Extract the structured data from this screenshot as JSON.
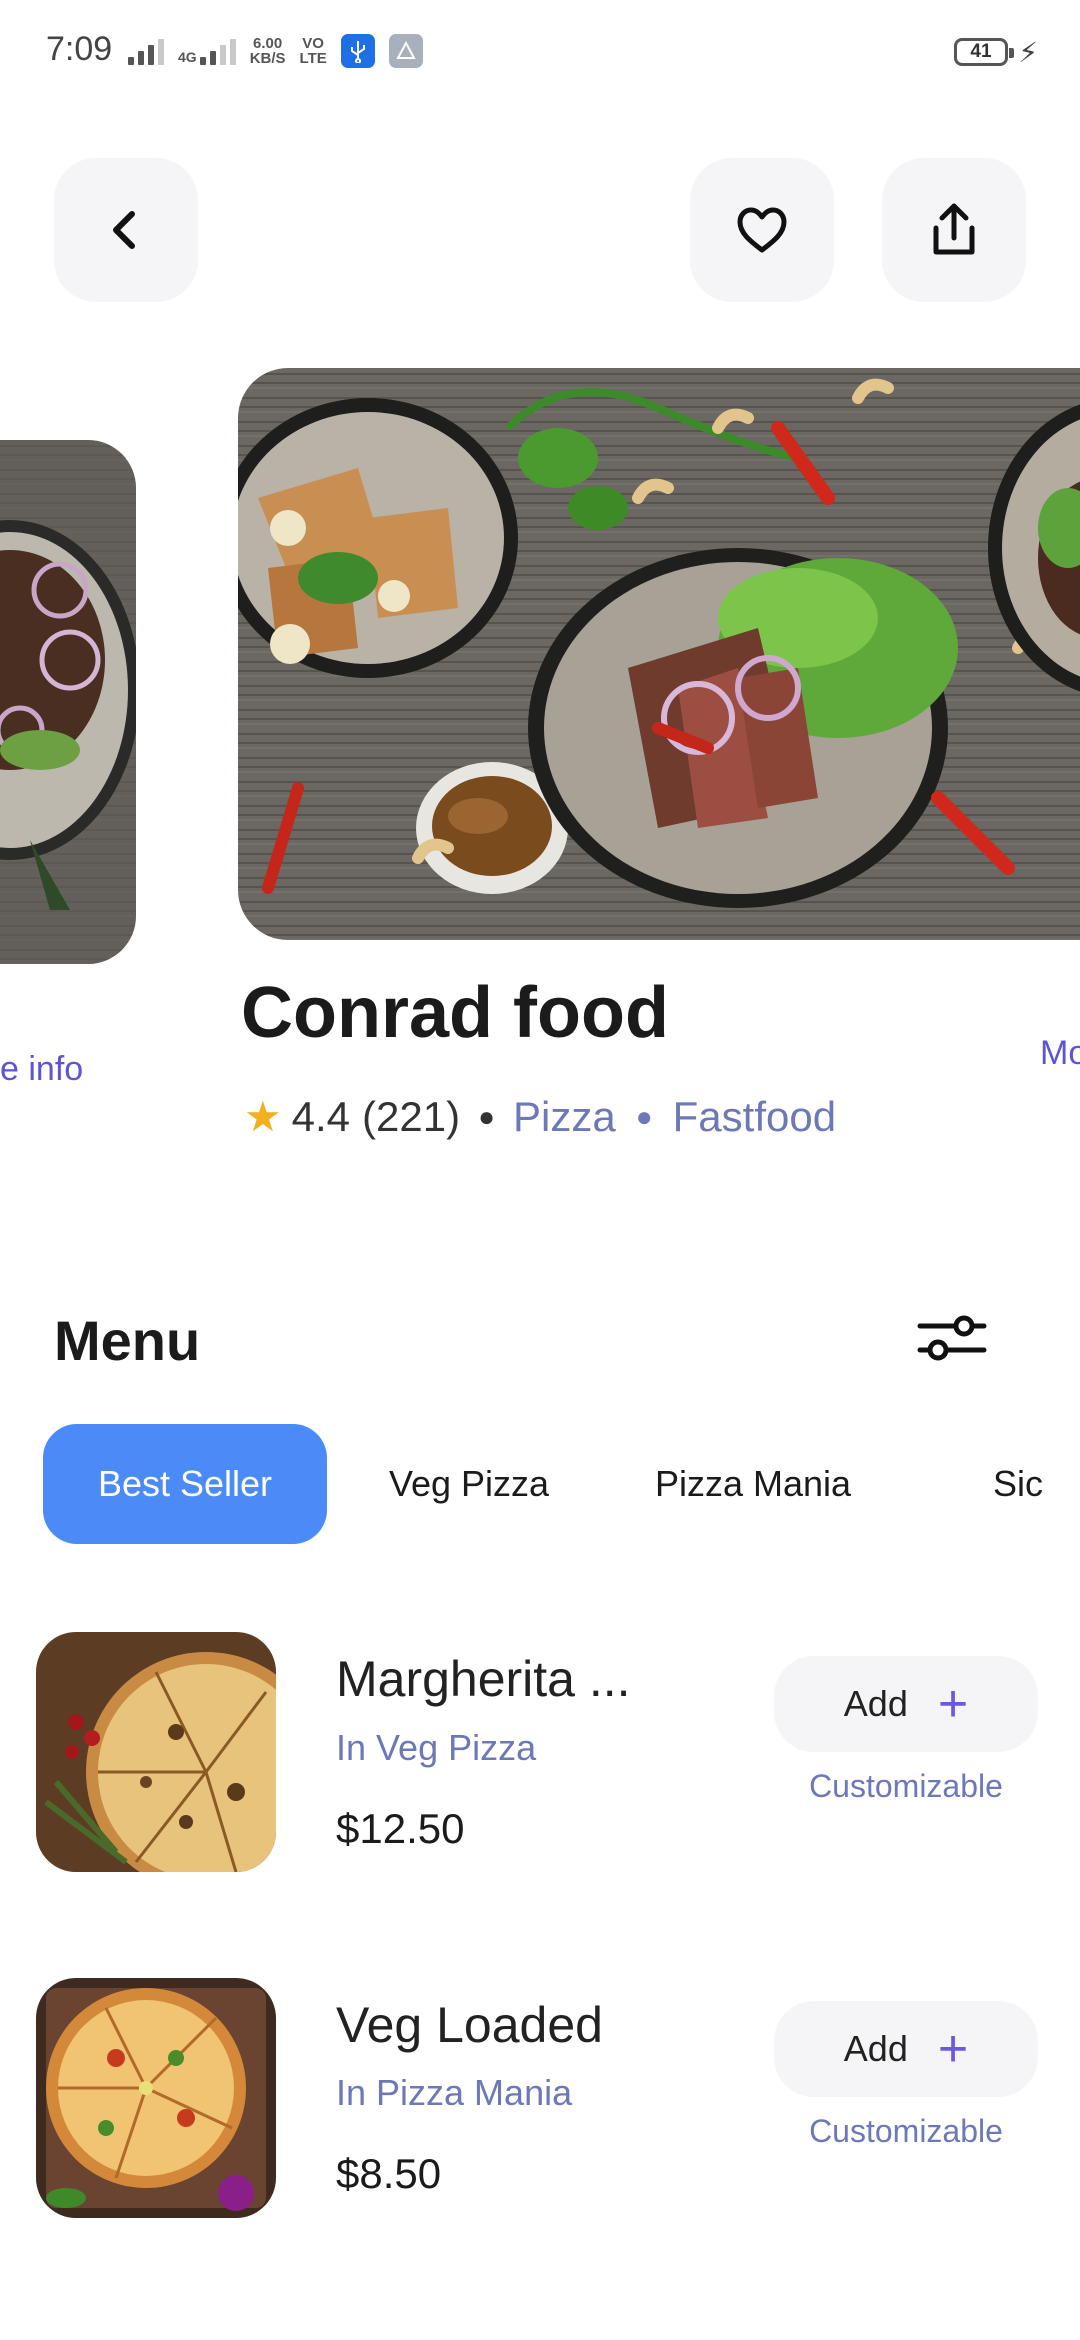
{
  "status_bar": {
    "time": "7:09",
    "network_type": "4G",
    "speed_value": "6.00",
    "speed_unit": "KB/S",
    "volte_top": "VO",
    "volte_bottom": "LTE",
    "battery_level": "41",
    "icons": [
      "signal-icon",
      "4g-signal-icon",
      "usb-icon",
      "navigation-icon",
      "battery-icon",
      "charging-bolt-icon"
    ]
  },
  "header": {
    "back_icon": "chevron-left-icon",
    "favorite_icon": "heart-icon",
    "share_icon": "share-icon"
  },
  "restaurant": {
    "name": "Conrad food",
    "rating": "4.4",
    "reviews": "(221)",
    "categories": [
      "Pizza",
      "Fastfood"
    ],
    "prev_card_link": "e info",
    "next_card_link": "Mo"
  },
  "menu": {
    "title": "Menu",
    "filter_icon": "sliders-icon",
    "tabs": [
      {
        "label": "Best Seller",
        "active": true
      },
      {
        "label": "Veg Pizza",
        "active": false
      },
      {
        "label": "Pizza Mania",
        "active": false
      },
      {
        "label": "Sic",
        "active": false
      }
    ],
    "items": [
      {
        "name": "Margherita ...",
        "category": "In Veg Pizza",
        "price": "$12.50",
        "add_label": "Add",
        "note": "Customizable"
      },
      {
        "name": "Veg Loaded",
        "category": "In Pizza Mania",
        "price": "$8.50",
        "add_label": "Add",
        "note": "Customizable"
      }
    ]
  },
  "colors": {
    "accent_blue": "#4a8bf7",
    "accent_purple": "#6a5ae0",
    "category_text": "#6c78b7",
    "star": "#f2b01e"
  }
}
